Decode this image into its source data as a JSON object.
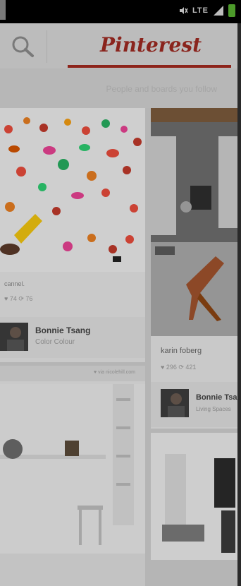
{
  "status_bar": {
    "network_label": "LTE",
    "icons": [
      "mute-icon",
      "signal-icon",
      "battery-icon"
    ]
  },
  "header": {
    "logo_text": "Pinterest",
    "search_icon": "search-icon",
    "accent_color": "#a1291f"
  },
  "subheader": {
    "text": "People and boards you follow"
  },
  "pins": [
    {
      "caption": "cannel.",
      "stats": "♥ 74   ⟳ 76",
      "pinner_name": "Bonnie Tsang",
      "board": "Color Colour"
    },
    {
      "source": "♥ via nicolehill.com"
    },
    {
      "caption": "karin foberg",
      "stats": "♥ 296   ⟳ 421",
      "pinner_name": "Bonnie Tsang",
      "board": "Living Spaces"
    },
    {}
  ]
}
